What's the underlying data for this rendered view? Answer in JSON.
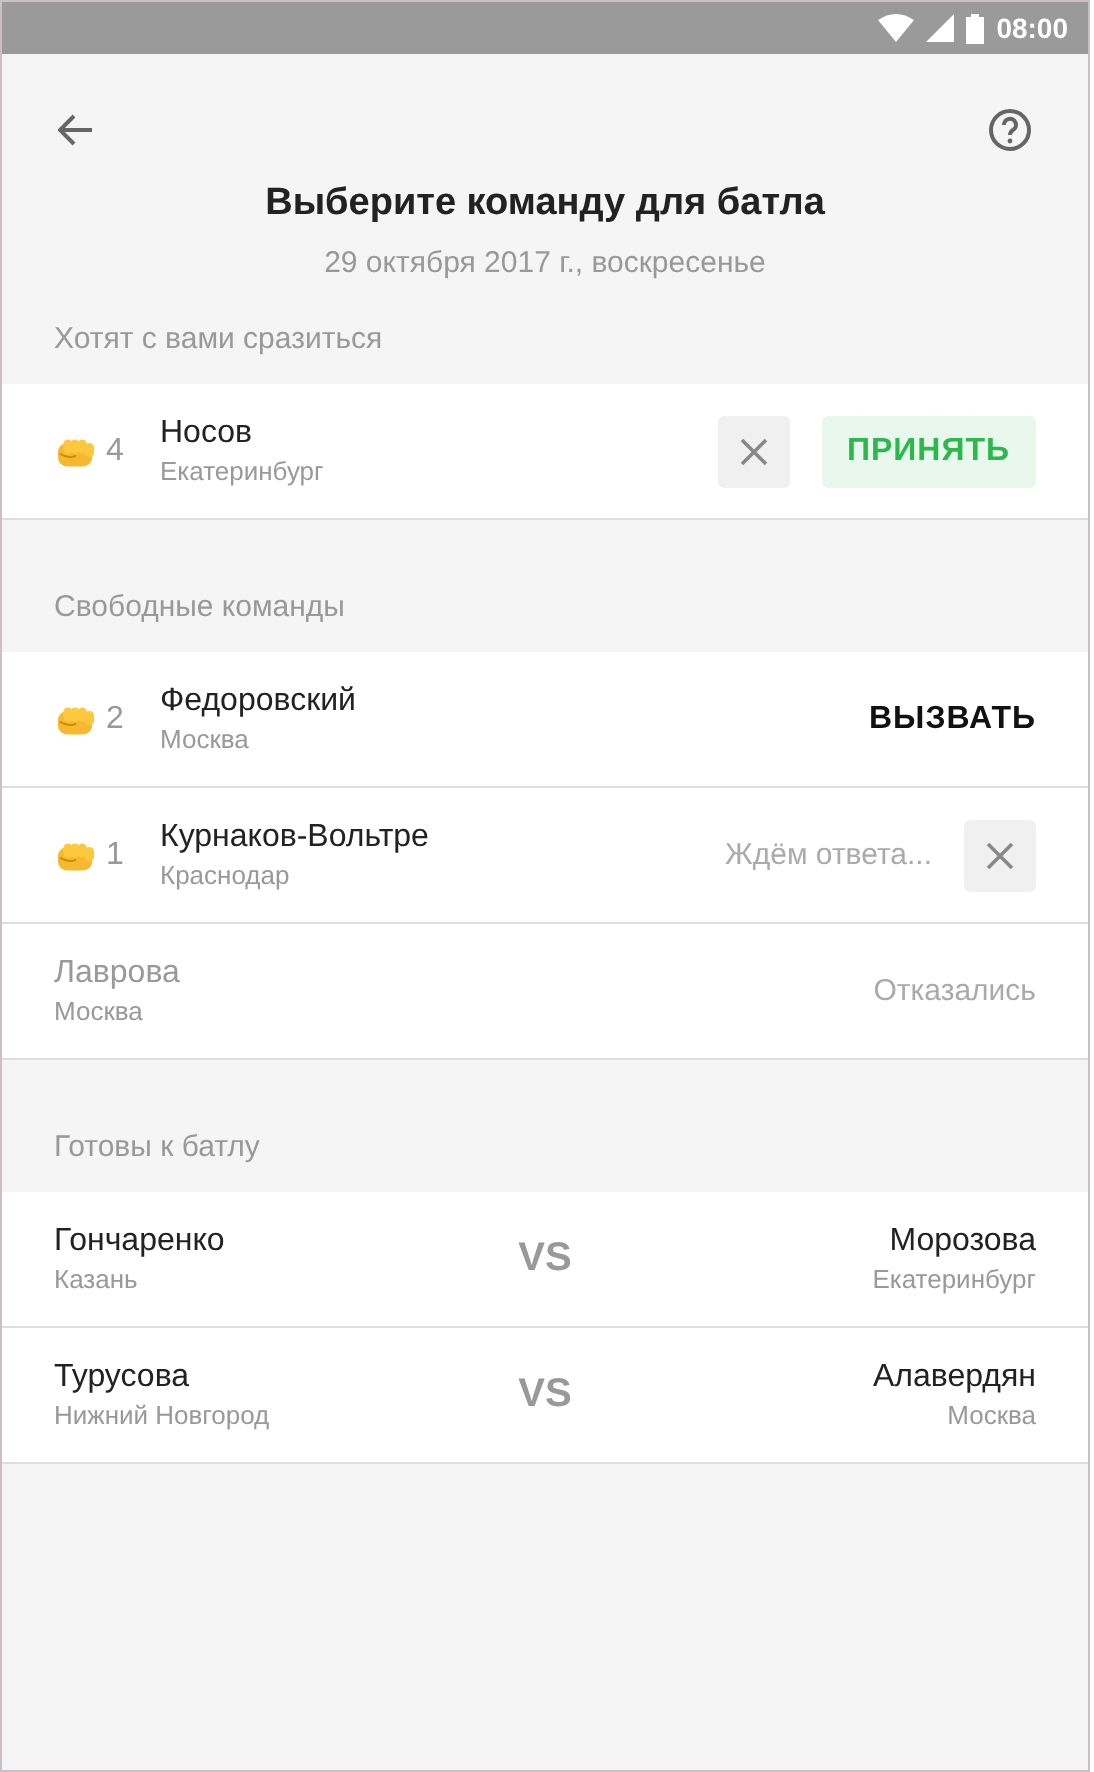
{
  "status_bar": {
    "time": "08:00"
  },
  "header": {
    "title": "Выберите команду для батла",
    "subtitle": "29 октября 2017 г., воскресенье"
  },
  "sections": [
    {
      "title": "Хотят с вами сразиться",
      "rows": [
        {
          "kind": "request",
          "count": "4",
          "name": "Носов",
          "city": "Екатеринбург",
          "action": "ПРИНЯТЬ"
        }
      ]
    },
    {
      "title": "Свободные команды",
      "rows": [
        {
          "kind": "challenge",
          "count": "2",
          "name": "Федоровский",
          "city": "Москва",
          "action": "ВЫЗВАТЬ"
        },
        {
          "kind": "waiting",
          "count": "1",
          "name": "Курнаков-Вольтре",
          "city": "Краснодар",
          "status": "Ждём ответа..."
        },
        {
          "kind": "declined",
          "name": "Лаврова",
          "city": "Москва",
          "status": "Отказались"
        }
      ]
    },
    {
      "title": "Готовы к батлу",
      "rows": [
        {
          "kind": "match",
          "name": "Гончаренко",
          "city": "Казань",
          "vs": "VS",
          "opponent": "Морозова",
          "opponent_city": "Екатеринбург"
        },
        {
          "kind": "match",
          "name": "Турусова",
          "city": "Нижний Новгород",
          "vs": "VS",
          "opponent": "Алавердян",
          "opponent_city": "Москва"
        }
      ]
    }
  ]
}
